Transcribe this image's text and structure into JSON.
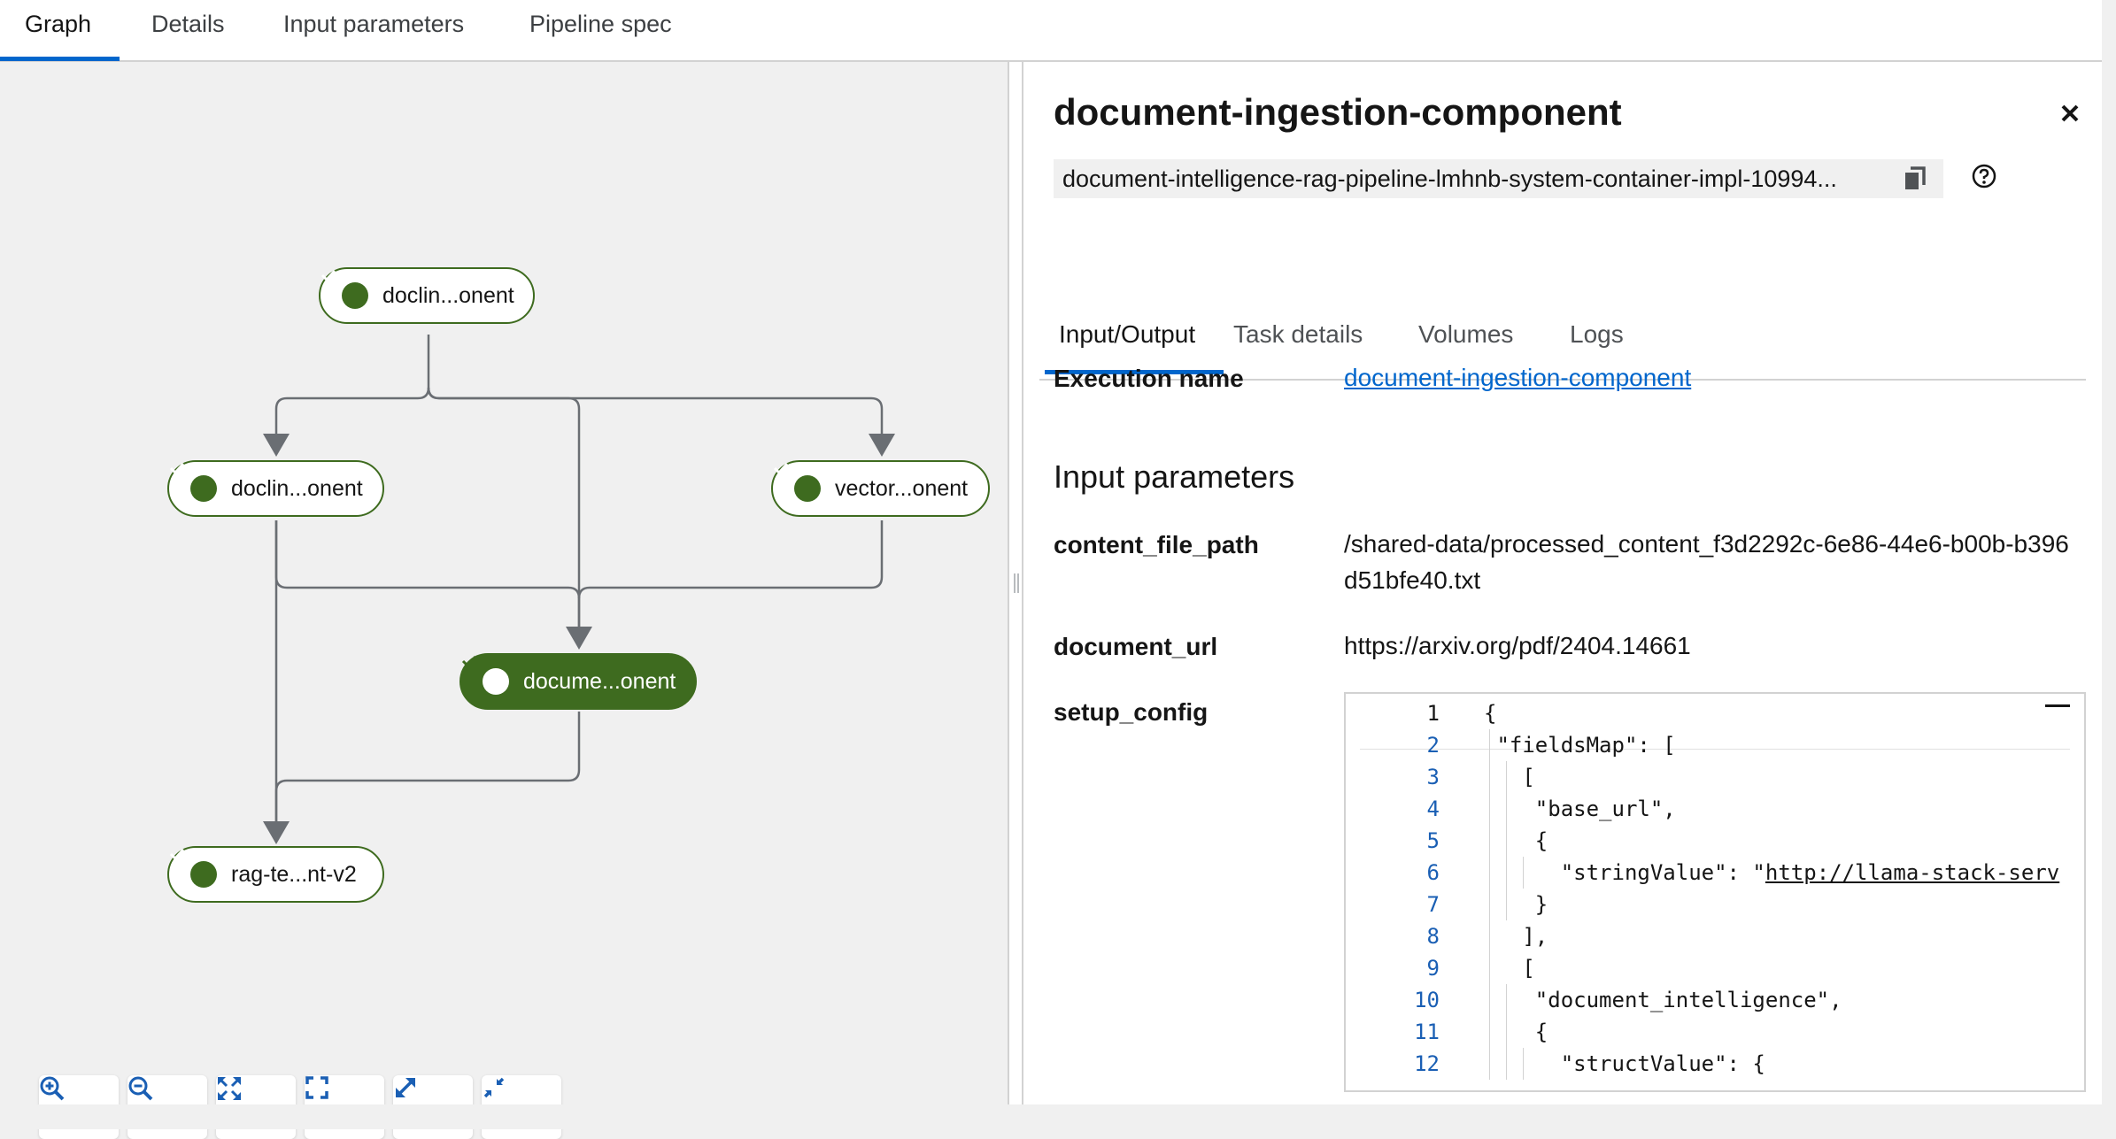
{
  "top_tabs": [
    {
      "label": "Graph",
      "active": true
    },
    {
      "label": "Details",
      "active": false
    },
    {
      "label": "Input parameters",
      "active": false
    },
    {
      "label": "Pipeline spec",
      "active": false
    }
  ],
  "graph": {
    "nodes": [
      {
        "id": "n1",
        "label": "doclin...onent",
        "status": "succeeded",
        "selected": false
      },
      {
        "id": "n2",
        "label": "doclin...onent",
        "status": "succeeded",
        "selected": false
      },
      {
        "id": "n3",
        "label": "vector...onent",
        "status": "succeeded",
        "selected": false
      },
      {
        "id": "n4",
        "label": "docume...onent",
        "status": "succeeded",
        "selected": true
      },
      {
        "id": "n5",
        "label": "rag-te...nt-v2",
        "status": "succeeded",
        "selected": false
      }
    ],
    "controls": [
      {
        "icon": "zoom-in-icon",
        "name": "zoom-in-button"
      },
      {
        "icon": "zoom-out-icon",
        "name": "zoom-out-button"
      },
      {
        "icon": "fit-to-screen-icon",
        "name": "fit-to-screen-button"
      },
      {
        "icon": "reset-view-icon",
        "name": "reset-view-button"
      },
      {
        "icon": "expand-icon",
        "name": "expand-button"
      },
      {
        "icon": "collapse-icon",
        "name": "collapse-button"
      }
    ]
  },
  "panel": {
    "title": "document-ingestion-component",
    "pod_name": "document-intelligence-rag-pipeline-lmhnb-system-container-impl-10994...",
    "tabs": [
      {
        "label": "Input/Output",
        "active": true
      },
      {
        "label": "Task details",
        "active": false
      },
      {
        "label": "Volumes",
        "active": false
      },
      {
        "label": "Logs",
        "active": false
      }
    ],
    "execution_name_label": "Execution name",
    "execution_name_value": "document-ingestion-component",
    "input_parameters_heading": "Input parameters",
    "params": [
      {
        "name": "content_file_path",
        "value": "/shared-data/processed_content_f3d2292c-6e86-44e6-b00b-b396d51bfe40.txt"
      },
      {
        "name": "document_url",
        "value": "https://arxiv.org/pdf/2404.14661"
      },
      {
        "name": "setup_config",
        "value": ""
      }
    ],
    "code_lines": [
      {
        "n": "1",
        "text": "{",
        "link": ""
      },
      {
        "n": "2",
        "text": " \"fieldsMap\": [",
        "link": ""
      },
      {
        "n": "3",
        "text": "   [",
        "link": ""
      },
      {
        "n": "4",
        "text": "    \"base_url\",",
        "link": ""
      },
      {
        "n": "5",
        "text": "    {",
        "link": ""
      },
      {
        "n": "6",
        "text": "      \"stringValue\": \"",
        "link": "http://llama-stack-serv"
      },
      {
        "n": "7",
        "text": "    }",
        "link": ""
      },
      {
        "n": "8",
        "text": "   ],",
        "link": ""
      },
      {
        "n": "9",
        "text": "   [",
        "link": ""
      },
      {
        "n": "10",
        "text": "    \"document_intelligence\",",
        "link": ""
      },
      {
        "n": "11",
        "text": "    {",
        "link": ""
      },
      {
        "n": "12",
        "text": "      \"structValue\": {",
        "link": ""
      }
    ]
  },
  "colors": {
    "accent": "#0066cc",
    "success": "#3e6b1f",
    "edge": "#6a6e73"
  }
}
